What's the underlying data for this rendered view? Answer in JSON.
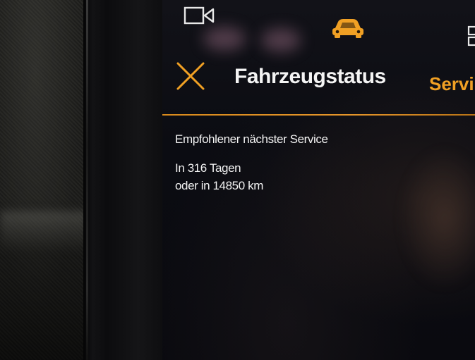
{
  "screen": {
    "title": "Fahrzeugstatus",
    "tab_label": "Servi",
    "accent_color": "#f0a024",
    "icons": {
      "left": "camera-view-icon",
      "center": "car-status-icon",
      "right": "grid-menu-icon",
      "close": "close-icon"
    }
  },
  "service": {
    "heading": "Empfohlener nächster Service",
    "days": "In 316 Tagen",
    "distance": "oder in 14850 km"
  }
}
